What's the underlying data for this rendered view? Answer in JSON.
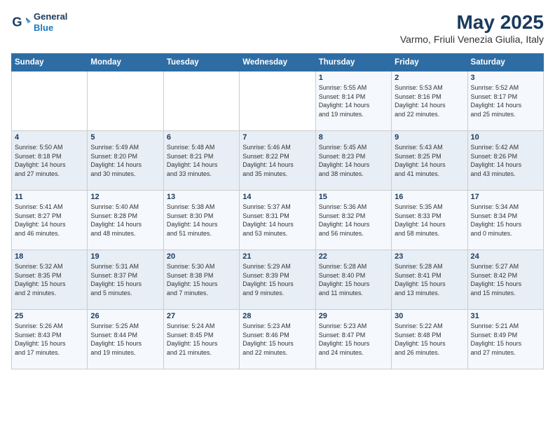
{
  "logo": {
    "line1": "General",
    "line2": "Blue"
  },
  "title": "May 2025",
  "subtitle": "Varmo, Friuli Venezia Giulia, Italy",
  "days_of_week": [
    "Sunday",
    "Monday",
    "Tuesday",
    "Wednesday",
    "Thursday",
    "Friday",
    "Saturday"
  ],
  "weeks": [
    [
      {
        "num": "",
        "info": ""
      },
      {
        "num": "",
        "info": ""
      },
      {
        "num": "",
        "info": ""
      },
      {
        "num": "",
        "info": ""
      },
      {
        "num": "1",
        "info": "Sunrise: 5:55 AM\nSunset: 8:14 PM\nDaylight: 14 hours\nand 19 minutes."
      },
      {
        "num": "2",
        "info": "Sunrise: 5:53 AM\nSunset: 8:16 PM\nDaylight: 14 hours\nand 22 minutes."
      },
      {
        "num": "3",
        "info": "Sunrise: 5:52 AM\nSunset: 8:17 PM\nDaylight: 14 hours\nand 25 minutes."
      }
    ],
    [
      {
        "num": "4",
        "info": "Sunrise: 5:50 AM\nSunset: 8:18 PM\nDaylight: 14 hours\nand 27 minutes."
      },
      {
        "num": "5",
        "info": "Sunrise: 5:49 AM\nSunset: 8:20 PM\nDaylight: 14 hours\nand 30 minutes."
      },
      {
        "num": "6",
        "info": "Sunrise: 5:48 AM\nSunset: 8:21 PM\nDaylight: 14 hours\nand 33 minutes."
      },
      {
        "num": "7",
        "info": "Sunrise: 5:46 AM\nSunset: 8:22 PM\nDaylight: 14 hours\nand 35 minutes."
      },
      {
        "num": "8",
        "info": "Sunrise: 5:45 AM\nSunset: 8:23 PM\nDaylight: 14 hours\nand 38 minutes."
      },
      {
        "num": "9",
        "info": "Sunrise: 5:43 AM\nSunset: 8:25 PM\nDaylight: 14 hours\nand 41 minutes."
      },
      {
        "num": "10",
        "info": "Sunrise: 5:42 AM\nSunset: 8:26 PM\nDaylight: 14 hours\nand 43 minutes."
      }
    ],
    [
      {
        "num": "11",
        "info": "Sunrise: 5:41 AM\nSunset: 8:27 PM\nDaylight: 14 hours\nand 46 minutes."
      },
      {
        "num": "12",
        "info": "Sunrise: 5:40 AM\nSunset: 8:28 PM\nDaylight: 14 hours\nand 48 minutes."
      },
      {
        "num": "13",
        "info": "Sunrise: 5:38 AM\nSunset: 8:30 PM\nDaylight: 14 hours\nand 51 minutes."
      },
      {
        "num": "14",
        "info": "Sunrise: 5:37 AM\nSunset: 8:31 PM\nDaylight: 14 hours\nand 53 minutes."
      },
      {
        "num": "15",
        "info": "Sunrise: 5:36 AM\nSunset: 8:32 PM\nDaylight: 14 hours\nand 56 minutes."
      },
      {
        "num": "16",
        "info": "Sunrise: 5:35 AM\nSunset: 8:33 PM\nDaylight: 14 hours\nand 58 minutes."
      },
      {
        "num": "17",
        "info": "Sunrise: 5:34 AM\nSunset: 8:34 PM\nDaylight: 15 hours\nand 0 minutes."
      }
    ],
    [
      {
        "num": "18",
        "info": "Sunrise: 5:32 AM\nSunset: 8:35 PM\nDaylight: 15 hours\nand 2 minutes."
      },
      {
        "num": "19",
        "info": "Sunrise: 5:31 AM\nSunset: 8:37 PM\nDaylight: 15 hours\nand 5 minutes."
      },
      {
        "num": "20",
        "info": "Sunrise: 5:30 AM\nSunset: 8:38 PM\nDaylight: 15 hours\nand 7 minutes."
      },
      {
        "num": "21",
        "info": "Sunrise: 5:29 AM\nSunset: 8:39 PM\nDaylight: 15 hours\nand 9 minutes."
      },
      {
        "num": "22",
        "info": "Sunrise: 5:28 AM\nSunset: 8:40 PM\nDaylight: 15 hours\nand 11 minutes."
      },
      {
        "num": "23",
        "info": "Sunrise: 5:28 AM\nSunset: 8:41 PM\nDaylight: 15 hours\nand 13 minutes."
      },
      {
        "num": "24",
        "info": "Sunrise: 5:27 AM\nSunset: 8:42 PM\nDaylight: 15 hours\nand 15 minutes."
      }
    ],
    [
      {
        "num": "25",
        "info": "Sunrise: 5:26 AM\nSunset: 8:43 PM\nDaylight: 15 hours\nand 17 minutes."
      },
      {
        "num": "26",
        "info": "Sunrise: 5:25 AM\nSunset: 8:44 PM\nDaylight: 15 hours\nand 19 minutes."
      },
      {
        "num": "27",
        "info": "Sunrise: 5:24 AM\nSunset: 8:45 PM\nDaylight: 15 hours\nand 21 minutes."
      },
      {
        "num": "28",
        "info": "Sunrise: 5:23 AM\nSunset: 8:46 PM\nDaylight: 15 hours\nand 22 minutes."
      },
      {
        "num": "29",
        "info": "Sunrise: 5:23 AM\nSunset: 8:47 PM\nDaylight: 15 hours\nand 24 minutes."
      },
      {
        "num": "30",
        "info": "Sunrise: 5:22 AM\nSunset: 8:48 PM\nDaylight: 15 hours\nand 26 minutes."
      },
      {
        "num": "31",
        "info": "Sunrise: 5:21 AM\nSunset: 8:49 PM\nDaylight: 15 hours\nand 27 minutes."
      }
    ]
  ]
}
